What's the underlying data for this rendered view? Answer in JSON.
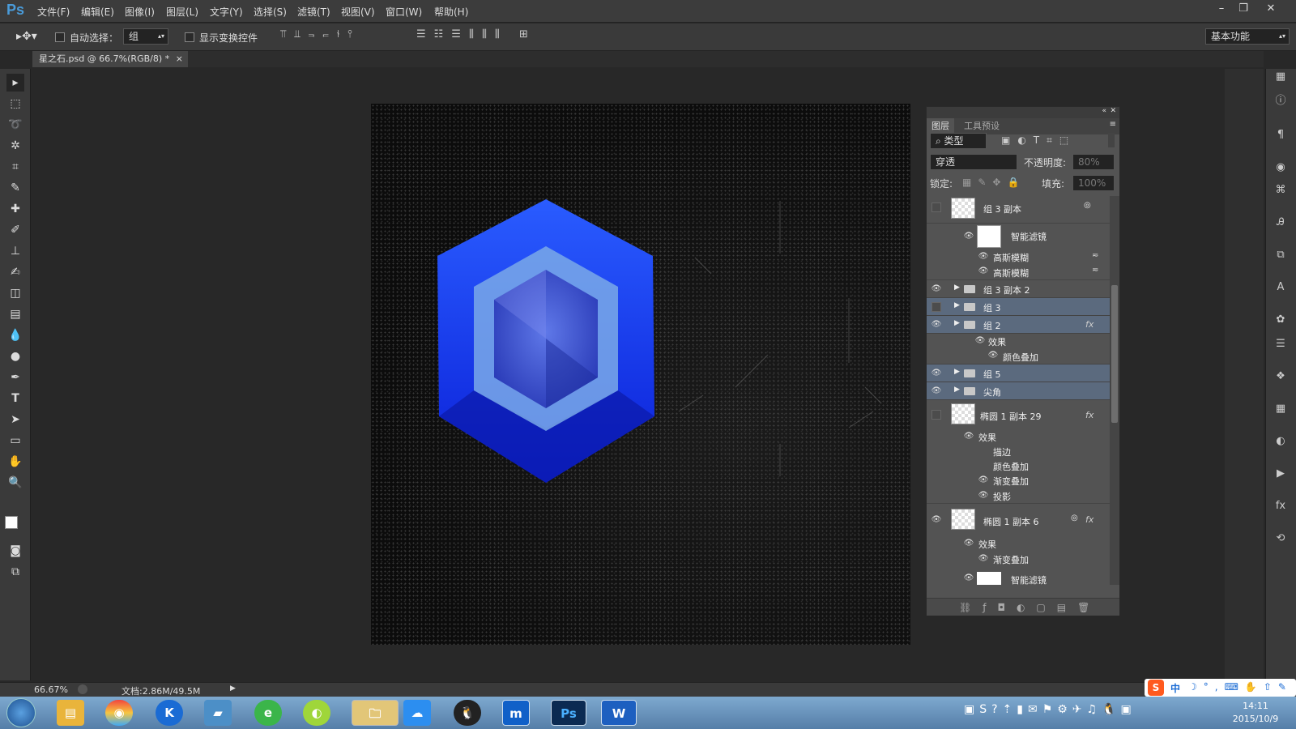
{
  "app": {
    "logo": "Ps"
  },
  "menu": [
    "文件(F)",
    "编辑(E)",
    "图像(I)",
    "图层(L)",
    "文字(Y)",
    "选择(S)",
    "滤镜(T)",
    "视图(V)",
    "窗口(W)",
    "帮助(H)"
  ],
  "options": {
    "auto_select_label": "自动选择：",
    "auto_select_value": "组",
    "show_transform_label": "显示变换控件",
    "workspace": "基本功能"
  },
  "document": {
    "tab_title": "星之石.psd @ 66.7%(RGB/8) *",
    "zoom": "66.67%",
    "doc_info": "文档:2.86M/49.5M"
  },
  "layers_panel": {
    "tabs": [
      "图层",
      "工具预设"
    ],
    "filter_kind": "类型",
    "blend_mode": "穿透",
    "opacity_label": "不透明度:",
    "opacity_value": "80%",
    "lock_label": "锁定:",
    "fill_label": "填充:",
    "fill_value": "100%",
    "rows": [
      {
        "name": "组 3 副本",
        "type": "smart"
      },
      {
        "name": "智能滤镜",
        "type": "sub-filter"
      },
      {
        "name": "高斯模糊",
        "type": "sub-item"
      },
      {
        "name": "高斯模糊",
        "type": "sub-item"
      },
      {
        "name": "组 3 副本 2",
        "type": "group"
      },
      {
        "name": "组 3",
        "type": "group"
      },
      {
        "name": "组 2",
        "type": "group"
      },
      {
        "name": "效果",
        "type": "sub"
      },
      {
        "name": "颜色叠加",
        "type": "sub-item"
      },
      {
        "name": "组 5",
        "type": "group"
      },
      {
        "name": "尖角",
        "type": "group"
      },
      {
        "name": "椭圆 1 副本 29",
        "type": "layer"
      },
      {
        "name": "效果",
        "type": "sub"
      },
      {
        "name": "描边",
        "type": "sub-item"
      },
      {
        "name": "颜色叠加",
        "type": "sub-item"
      },
      {
        "name": "渐变叠加",
        "type": "sub-item"
      },
      {
        "name": "投影",
        "type": "sub-item"
      },
      {
        "name": "椭圆 1 副本 6",
        "type": "layer"
      },
      {
        "name": "效果",
        "type": "sub"
      },
      {
        "name": "渐变叠加",
        "type": "sub-item"
      },
      {
        "name": "智能滤镜",
        "type": "sub-filter"
      }
    ]
  },
  "taskbar": {
    "time": "14:11",
    "date": "2015/10/9"
  },
  "ime": {
    "lang": "中"
  },
  "colors": {
    "gem_blue": "#1a3cff",
    "gem_light": "#7aa9e8",
    "panel_bg": "#535353",
    "selected_row": "#5b6a7e"
  }
}
